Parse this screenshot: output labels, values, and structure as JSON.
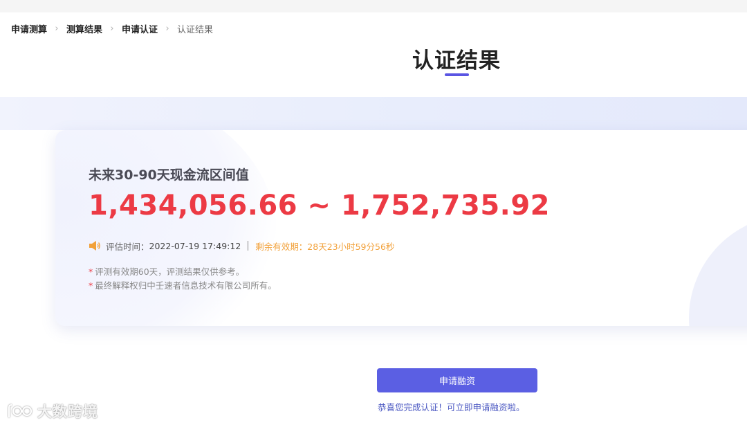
{
  "breadcrumb": {
    "items": [
      {
        "label": "申请测算"
      },
      {
        "label": "测算结果"
      },
      {
        "label": "申请认证"
      },
      {
        "label": "认证结果"
      }
    ]
  },
  "page": {
    "title": "认证结果"
  },
  "result": {
    "label": "未来30-90天现金流区间值",
    "value": "1,434,056.66 ~ 1,752,735.92",
    "eval_label": "评估时间：",
    "eval_time": "2022-07-19 17:49:12",
    "remaining_label": "剩余有效期：",
    "remaining_value": "28天23小时59分56秒",
    "speaker_icon": "speaker-icon",
    "notes": [
      "评测有效期60天，评测结果仅供参考。",
      "最终解释权归中壬速者信息技术有限公司所有。"
    ]
  },
  "actions": {
    "apply_label": "申请融资",
    "congrats_text": "恭喜您完成认证！可立即申请融资啦。"
  },
  "watermark": {
    "text": "大数跨境",
    "icon": "logo-icon"
  },
  "colors": {
    "accent": "#5a55e3",
    "button": "#5b5fe3",
    "value_red": "#ec3a44",
    "remaining_orange": "#f2a13a",
    "link_blue": "#4a57c2"
  }
}
